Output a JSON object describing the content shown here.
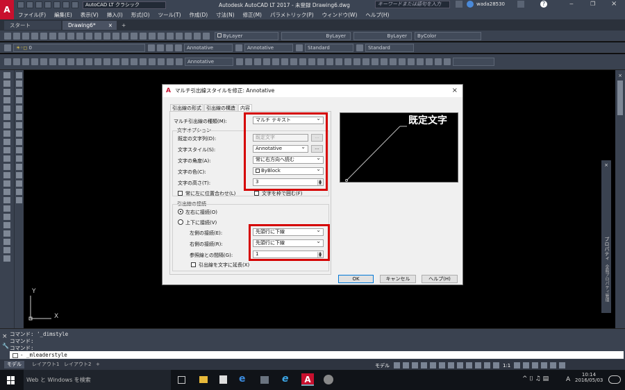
{
  "titlebar": {
    "workspace": "AutoCAD LT クラシック",
    "title": "Autodesk AutoCAD LT 2017 - 未登録    Drawing6.dwg",
    "search_placeholder": "キーワードまたは語句を入力",
    "user": "wada28530",
    "logo": "A"
  },
  "menu": [
    "ファイル(F)",
    "編集(E)",
    "表示(V)",
    "挿入(I)",
    "形式(O)",
    "ツール(T)",
    "作成(D)",
    "寸法(N)",
    "修正(M)",
    "パラメトリック(P)",
    "ウィンドウ(W)",
    "ヘルプ(H)"
  ],
  "doc_tabs": {
    "start": "スタート",
    "drawing": "Drawing6*"
  },
  "toolbar1": {
    "layer_color": "ByLayer",
    "linetype": "ByLayer",
    "lineweight": "ByLayer",
    "plotstyle": "ByColor"
  },
  "toolbar2": {
    "layer": "0",
    "text_style": "Annotative",
    "dim_style": "Annotative",
    "table_style": "Standard",
    "mleader_style": "Standard"
  },
  "toolbar3": {
    "mleader": "Annotative"
  },
  "canvas": {
    "ucs_x": "X",
    "ucs_y": "Y"
  },
  "command": {
    "lines": [
      "コマンド: '_dimstyle",
      "コマンド:",
      "コマンド:"
    ],
    "input": "- _mleaderstyle"
  },
  "layout_tabs": [
    "モデル",
    "レイアウト1",
    "レイアウト2"
  ],
  "status": {
    "model": "モデル",
    "scale": "1:1"
  },
  "right_panel": {
    "label": "プロパティ",
    "label2": "全般プロパティ管理"
  },
  "taskbar": {
    "search": "Web と Windows を検索",
    "time": "10:14",
    "date": "2016/05/03",
    "ime": "A"
  },
  "dialog": {
    "title": "マルチ引出線スタイルを修正: Annotative",
    "tabs": [
      "引出線の形式",
      "引出線の構造",
      "内容"
    ],
    "mleader_type_label": "マルチ引出線の種類(M):",
    "mleader_type_value": "マルチ テキスト",
    "text_options_group": "文字オプション",
    "default_text_label": "既定の文字列(D):",
    "default_text_value": "既定文字",
    "text_style_label": "文字スタイル(S):",
    "text_style_value": "Annotative",
    "text_angle_label": "文字の角度(A):",
    "text_angle_value": "常に右方向へ読む",
    "text_color_label": "文字の色(C):",
    "text_color_value": "ByBlock",
    "text_height_label": "文字の高さ(T):",
    "text_height_value": "3",
    "always_left_label": "常に左に位置合わせ(L)",
    "frame_label": "文字を枠で囲む(F)",
    "attach_group": "引出線の接続",
    "horizontal_label": "左右に接続(O)",
    "vertical_label": "上下に接続(V)",
    "left_attach_label": "左側の接続(E):",
    "left_attach_value": "先頭行に下線",
    "right_attach_label": "右側の接続(R):",
    "right_attach_value": "先頭行に下線",
    "landing_gap_label": "参照線との間隔(G):",
    "landing_gap_value": "1",
    "extend_label": "引出線を文字に延長(X)",
    "preview_text": "既定文字",
    "ok": "OK",
    "cancel": "キャンセル",
    "help": "ヘルプ(H)",
    "close": "×",
    "browse": "..."
  }
}
